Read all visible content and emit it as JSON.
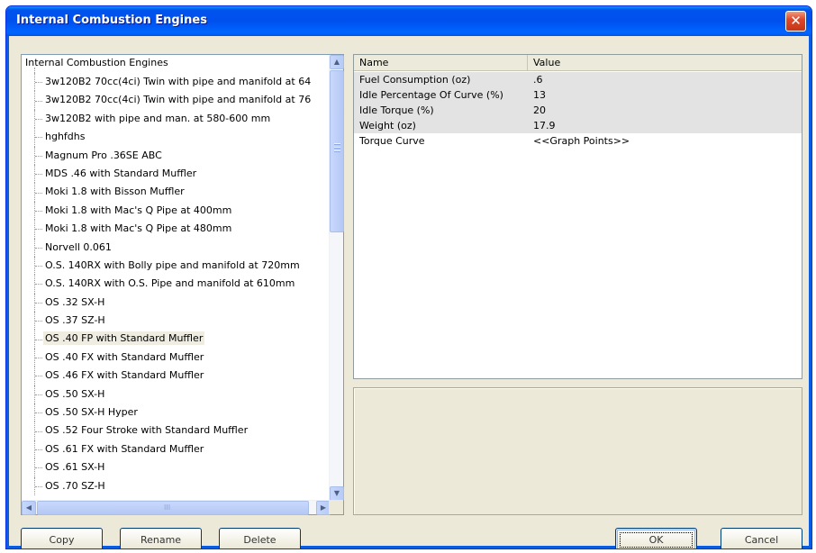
{
  "window": {
    "title": "Internal Combustion Engines",
    "close_label": "✕"
  },
  "tree": {
    "root": "Internal Combustion Engines",
    "items": [
      "3w120B2 70cc(4ci) Twin with pipe and manifold at 64",
      "3w120B2 70cc(4ci) Twin with pipe and manifold at 76",
      "3w120B2 with pipe and man. at 580-600 mm",
      "hghfdhs",
      "Magnum Pro .36SE ABC",
      "MDS .46 with Standard Muffler",
      "Moki 1.8 with Bisson Muffler",
      "Moki 1.8 with Mac's Q Pipe at 400mm",
      "Moki 1.8 with Mac's Q Pipe at 480mm",
      "Norvell 0.061",
      "O.S. 140RX with Bolly pipe and manifold at 720mm",
      "O.S. 140RX with O.S. Pipe and manifold at 610mm",
      "OS .32 SX-H",
      "OS .37 SZ-H",
      "OS .40 FP with Standard Muffler",
      "OS .40 FX with Standard Muffler",
      "OS .46 FX with Standard Muffler",
      "OS .50 SX-H",
      "OS .50 SX-H Hyper",
      "OS .52 Four Stroke with Standard Muffler",
      "OS .61 FX with Standard Muffler",
      "OS .61 SX-H",
      "OS .70 SZ-H"
    ],
    "selected_index": 14,
    "hscroll_grip": "III"
  },
  "grid": {
    "headers": {
      "name": "Name",
      "value": "Value"
    },
    "rows": [
      {
        "name": "Fuel Consumption (oz)",
        "value": ".6"
      },
      {
        "name": "Idle Percentage Of Curve (%)",
        "value": "13"
      },
      {
        "name": "Idle Torque (%)",
        "value": "20"
      },
      {
        "name": "Weight (oz)",
        "value": "17.9"
      },
      {
        "name": "Torque Curve",
        "value": "<<Graph Points>>"
      }
    ]
  },
  "buttons": {
    "copy": "Copy",
    "rename": "Rename",
    "delete": "Delete",
    "ok": "OK",
    "cancel": "Cancel"
  },
  "icons": {
    "close": "close-icon",
    "scroll_up": "▲",
    "scroll_down": "▼",
    "scroll_left": "◀",
    "scroll_right": "▶"
  }
}
